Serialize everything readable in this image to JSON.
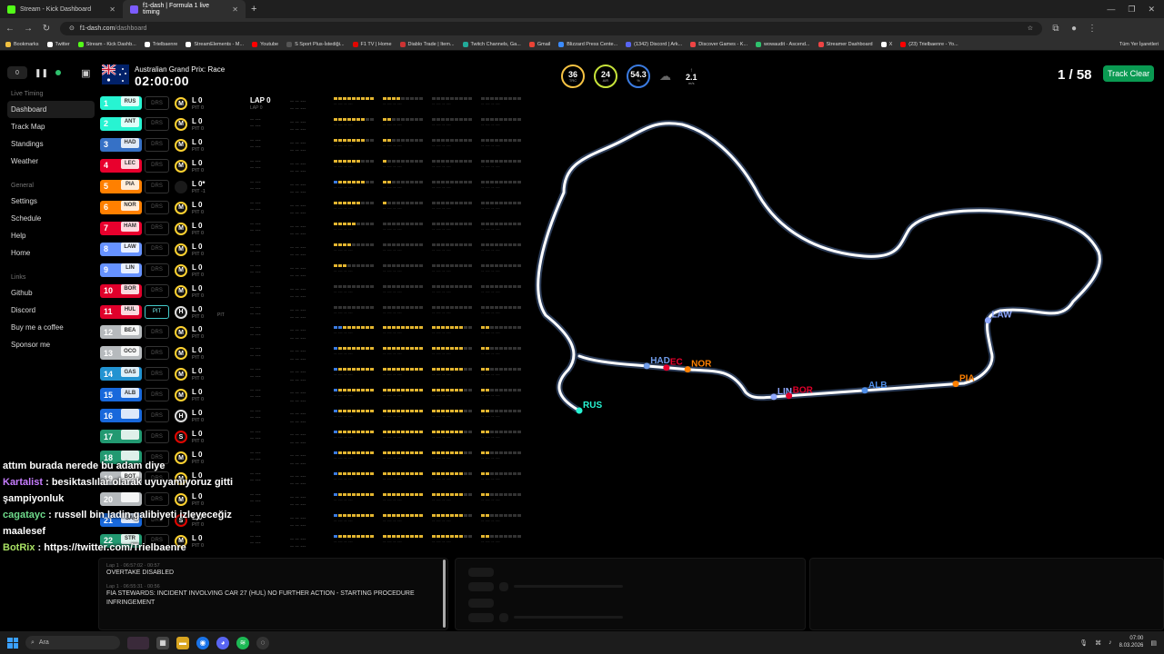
{
  "browser": {
    "tabs": [
      {
        "label": "Stream - Kick Dashboard",
        "color": "#53fc18"
      },
      {
        "label": "f1-dash | Formula 1 live timing",
        "color": "#7c5cff"
      }
    ],
    "url_host": "f1-dash.com",
    "url_path": "/dashboard",
    "bookmarks": [
      "Bookmarks",
      "Twitter",
      "Stream - Kick Dashb...",
      "Trielbaenre",
      "StreamElements - M...",
      "Youtube",
      "S Sport Plus-İstediği...",
      "F1 TV | Home",
      "Diablo Trade | Item...",
      "Twitch Channels, Ga...",
      "Gmail",
      "Blizzard Press Cente...",
      "(1342) Discord | Ark...",
      "Discover Games - K...",
      "wowaudit - Ascend...",
      "Streamer Dashboard",
      "X",
      "(23) Trielbaenre - Yo..."
    ],
    "bookmarks_all": "Tüm Yer İşaretleri"
  },
  "header": {
    "delay": "0",
    "race": "Australian Grand Prix: Race",
    "timer": "02:00:00",
    "weather": {
      "trc": "36",
      "trc_unit": "TRC",
      "air": "24",
      "air_unit": "AIR",
      "hum": "54.3",
      "hum_unit": "%",
      "wind": "2.1",
      "wind_unit": "m/s"
    },
    "lap": "1 / 58",
    "track_status": "Track Clear"
  },
  "sidebar": {
    "group1": "Live Timing",
    "items1": [
      "Dashboard",
      "Track Map",
      "Standings",
      "Weather"
    ],
    "group2": "General",
    "items2": [
      "Settings",
      "Schedule",
      "Help",
      "Home"
    ],
    "group3": "Links",
    "items3": [
      "Github",
      "Discord",
      "Buy me a coffee",
      "Sponsor me"
    ]
  },
  "drivers": [
    {
      "pos": "1",
      "tla": "RUS",
      "color": "#27f4d2",
      "drs": "DRS",
      "tyre": "M",
      "lap": "L 0",
      "pit": "PIT 0",
      "gap": "LAP 0",
      "gap_sub": "LAP 0"
    },
    {
      "pos": "2",
      "tla": "ANT",
      "color": "#27f4d2",
      "drs": "DRS",
      "tyre": "M",
      "lap": "L 0",
      "pit": "PIT 0"
    },
    {
      "pos": "3",
      "tla": "HAD",
      "color": "#3671c6",
      "drs": "DRS",
      "tyre": "M",
      "lap": "L 0",
      "pit": "PIT 0"
    },
    {
      "pos": "4",
      "tla": "LEC",
      "color": "#e8002d",
      "drs": "DRS",
      "tyre": "M",
      "lap": "L 0",
      "pit": "PIT 0"
    },
    {
      "pos": "5",
      "tla": "PIA",
      "color": "#ff8000",
      "drs": "DRS",
      "tyre": "",
      "lap": "L 0*",
      "pit": "PIT -1"
    },
    {
      "pos": "6",
      "tla": "NOR",
      "color": "#ff8000",
      "drs": "DRS",
      "tyre": "M",
      "lap": "L 0",
      "pit": "PIT 0"
    },
    {
      "pos": "7",
      "tla": "HAM",
      "color": "#e8002d",
      "drs": "DRS",
      "tyre": "M",
      "lap": "L 0",
      "pit": "PIT 0"
    },
    {
      "pos": "8",
      "tla": "LAW",
      "color": "#6692ff",
      "drs": "DRS",
      "tyre": "M",
      "lap": "L 0",
      "pit": "PIT 0"
    },
    {
      "pos": "9",
      "tla": "LIN",
      "color": "#6692ff",
      "drs": "DRS",
      "tyre": "M",
      "lap": "L 0",
      "pit": "PIT 0"
    },
    {
      "pos": "10",
      "tla": "BOR",
      "color": "#e0002b",
      "drs": "DRS",
      "tyre": "M",
      "lap": "L 0",
      "pit": "PIT 0"
    },
    {
      "pos": "11",
      "tla": "HUL",
      "color": "#e0002b",
      "drs": "PIT",
      "tyre": "H",
      "lap": "L 0",
      "pit": "PIT 0",
      "pit_extra": "PIT"
    },
    {
      "pos": "12",
      "tla": "BEA",
      "color": "#b6babd",
      "drs": "DRS",
      "tyre": "M",
      "lap": "L 0",
      "pit": "PIT 0"
    },
    {
      "pos": "13",
      "tla": "OCO",
      "color": "#b6babd",
      "drs": "DRS",
      "tyre": "M",
      "lap": "L 0",
      "pit": "PIT 0"
    },
    {
      "pos": "14",
      "tla": "GAS",
      "color": "#2293d1",
      "drs": "DRS",
      "tyre": "M",
      "lap": "L 0",
      "pit": "PIT 0"
    },
    {
      "pos": "15",
      "tla": "ALB",
      "color": "#1868db",
      "drs": "DRS",
      "tyre": "M",
      "lap": "L 0",
      "pit": "PIT 0"
    },
    {
      "pos": "16",
      "tla": "",
      "color": "#1868db",
      "drs": "DRS",
      "tyre": "H",
      "lap": "L 0",
      "pit": "PIT 0"
    },
    {
      "pos": "17",
      "tla": "",
      "color": "#229971",
      "drs": "DRS",
      "tyre": "S",
      "lap": "L 0",
      "pit": "PIT 0"
    },
    {
      "pos": "18",
      "tla": "",
      "color": "#229971",
      "drs": "DRS",
      "tyre": "M",
      "lap": "L 0",
      "pit": "PIT 0"
    },
    {
      "pos": "19",
      "tla": "BOT",
      "color": "#b6babd",
      "drs": "DRS",
      "tyre": "M",
      "lap": "L 0",
      "pit": "PIT 0"
    },
    {
      "pos": "20",
      "tla": "",
      "color": "#b6babd",
      "drs": "DRS",
      "tyre": "M",
      "lap": "L 0",
      "pit": "PIT 0"
    },
    {
      "pos": "21",
      "tla": "SAI",
      "color": "#1868db",
      "drs": "DRS",
      "tyre": "S",
      "lap": "L 0",
      "pit": "PIT 0"
    },
    {
      "pos": "22",
      "tla": "STR",
      "color": "#229971",
      "drs": "DRS",
      "tyre": "M",
      "lap": "L 0",
      "pit": "PIT 0"
    }
  ],
  "track_labels": [
    {
      "t": "RUS",
      "c": "#27f4d2"
    },
    {
      "t": "HAD",
      "c": "#6f9be8"
    },
    {
      "t": "EC",
      "c": "#e8002d"
    },
    {
      "t": "NOR",
      "c": "#ff8000"
    },
    {
      "t": "LAW",
      "c": "#8fa8ff"
    },
    {
      "t": "LIN",
      "c": "#8fa8ff"
    },
    {
      "t": "BOR",
      "c": "#e0002b"
    },
    {
      "t": "ALB",
      "c": "#4f8ee8"
    },
    {
      "t": "PIA",
      "c": "#ff8000"
    }
  ],
  "race_control": [
    {
      "time": "Lap 1 · 06:57:02 · 00:57",
      "text": "OVERTAKE DISABLED"
    },
    {
      "time": "Lap 1 · 06:55:31 · 00:56",
      "text": "FIA STEWARDS: INCIDENT INVOLVING CAR 27 (HUL) NO FURTHER ACTION - STARTING PROCEDURE INFRINGEMENT"
    }
  ],
  "chat": [
    {
      "user": "",
      "text": "attım burada nerede bu adam diye"
    },
    {
      "user": "Kartalist",
      "text": ": besiktaslılar olarak uyuyamıyoruz gitti şampiyonluk"
    },
    {
      "user": "cagatayc",
      "text": ": russell bin ladin galibiyeti izleyeceğiz maalesef"
    },
    {
      "user": "BotRix",
      "text": ": https://twitter.com/Trielbaenre"
    }
  ],
  "taskbar": {
    "search": "Ara",
    "time": "07:00",
    "date": "8.03.2026"
  }
}
